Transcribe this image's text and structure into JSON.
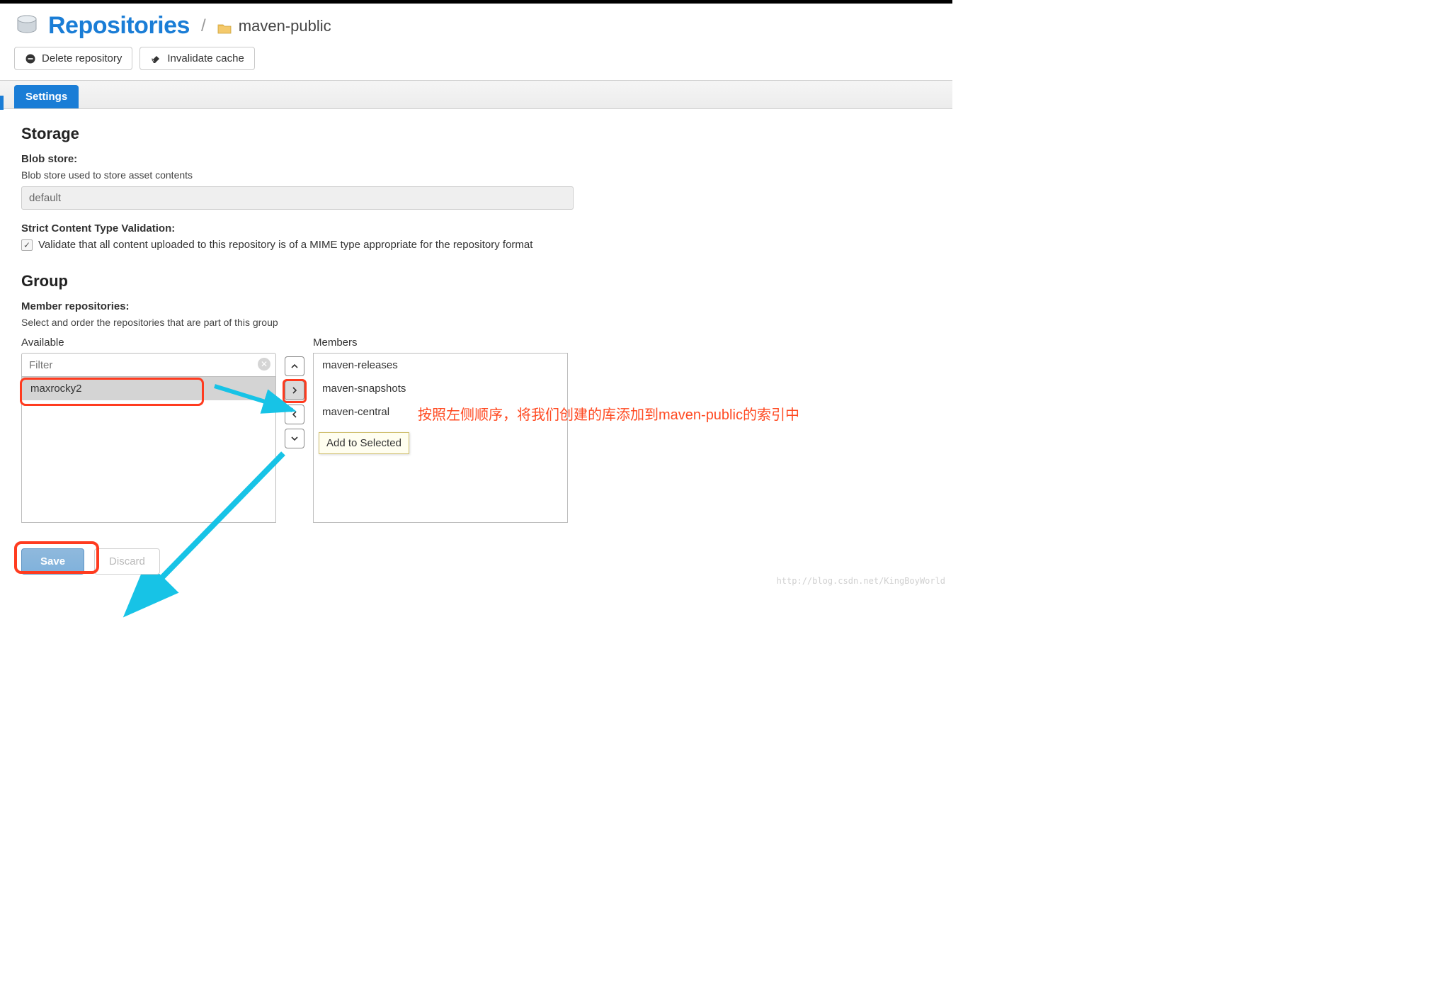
{
  "header": {
    "title": "Repositories",
    "repo_name": "maven-public"
  },
  "toolbar": {
    "delete_label": "Delete repository",
    "invalidate_label": "Invalidate cache"
  },
  "tabs": {
    "settings_label": "Settings"
  },
  "storage": {
    "section_title": "Storage",
    "blob_label": "Blob store:",
    "blob_help": "Blob store used to store asset contents",
    "blob_value": "default",
    "strict_label": "Strict Content Type Validation:",
    "strict_help": "Validate that all content uploaded to this repository is of a MIME type appropriate for the repository format"
  },
  "group": {
    "section_title": "Group",
    "member_label": "Member repositories:",
    "member_help": "Select and order the repositories that are part of this group",
    "available_label": "Available",
    "members_label": "Members",
    "filter_placeholder": "Filter",
    "available_items": [
      "maxrocky2"
    ],
    "members_items": [
      "maven-releases",
      "maven-snapshots",
      "maven-central"
    ],
    "tooltip_text": "Add to Selected"
  },
  "annotation": {
    "text": "按照左侧顺序，将我们创建的库添加到maven-public的索引中"
  },
  "footer": {
    "save_label": "Save",
    "discard_label": "Discard"
  },
  "watermark": "http://blog.csdn.net/KingBoyWorld"
}
